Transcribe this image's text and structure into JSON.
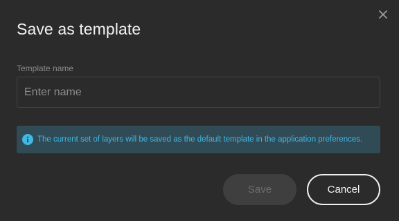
{
  "dialog": {
    "title": "Save as template",
    "close_icon": "close-icon",
    "field": {
      "label": "Template name",
      "value": "",
      "placeholder": "Enter name"
    },
    "info": {
      "icon": "info-icon",
      "text": "The current set of layers will be saved as the default template in the application preferences."
    },
    "buttons": {
      "save_label": "Save",
      "save_disabled": true,
      "cancel_label": "Cancel"
    }
  },
  "colors": {
    "background": "#2b2b2b",
    "info_background": "#304b56",
    "info_text": "#3fb8e6",
    "save_disabled_bg": "#3f3f3f",
    "cancel_border": "#f0f0f0"
  }
}
